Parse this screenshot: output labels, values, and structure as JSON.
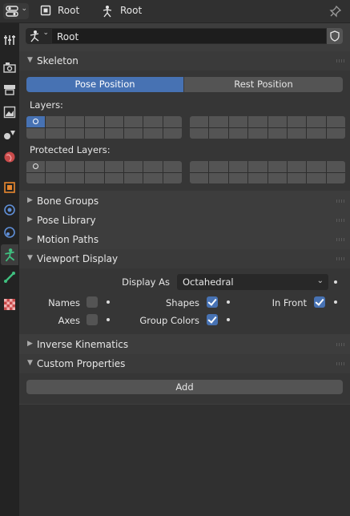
{
  "header": {
    "breadcrumbs": [
      {
        "label": "Root",
        "icon": "object-icon"
      },
      {
        "label": "Root",
        "icon": "armature-icon"
      }
    ]
  },
  "object_field": {
    "value": "Root"
  },
  "panels": {
    "skeleton": {
      "title": "Skeleton",
      "pose_position": "Pose Position",
      "rest_position": "Rest Position",
      "layers_label": "Layers:",
      "protected_layers_label": "Protected Layers:"
    },
    "bone_groups": {
      "title": "Bone Groups"
    },
    "pose_library": {
      "title": "Pose Library"
    },
    "motion_paths": {
      "title": "Motion Paths"
    },
    "viewport_display": {
      "title": "Viewport Display",
      "display_as_label": "Display As",
      "display_as_value": "Octahedral",
      "names_label": "Names",
      "names_checked": false,
      "shapes_label": "Shapes",
      "shapes_checked": true,
      "in_front_label": "In Front",
      "in_front_checked": true,
      "axes_label": "Axes",
      "axes_checked": false,
      "group_colors_label": "Group Colors",
      "group_colors_checked": true
    },
    "inverse_kinematics": {
      "title": "Inverse Kinematics"
    },
    "custom_properties": {
      "title": "Custom Properties",
      "add_label": "Add"
    }
  },
  "colors": {
    "accent": "#4772b3",
    "panel_bg": "#3d3d3d",
    "active_tab_green": "#3fbf7f"
  }
}
